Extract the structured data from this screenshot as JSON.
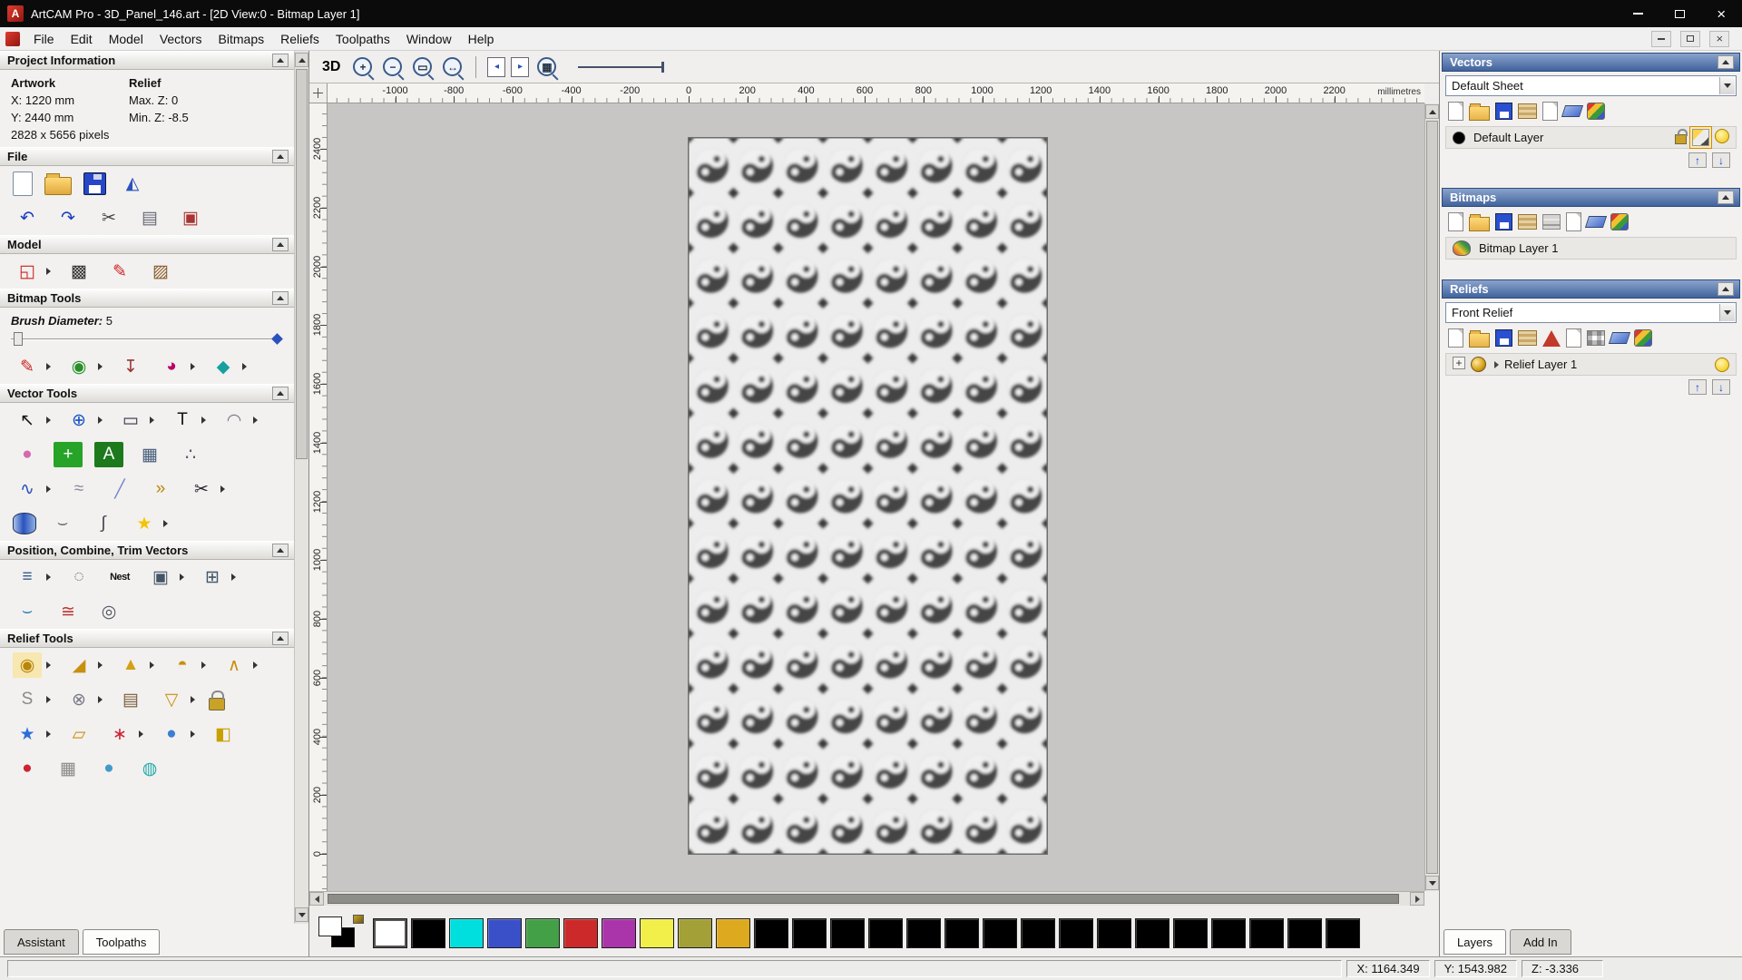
{
  "window": {
    "title": "ArtCAM Pro - 3D_Panel_146.art - [2D View:0 - Bitmap Layer 1]",
    "close_glyph": "×",
    "logo_letter": "A"
  },
  "menu": {
    "items": [
      "File",
      "Edit",
      "Model",
      "Vectors",
      "Bitmaps",
      "Reliefs",
      "Toolpaths",
      "Window",
      "Help"
    ]
  },
  "assistant": {
    "tabs": [
      {
        "label": "Assistant"
      },
      {
        "label": "Toolpaths"
      }
    ],
    "project_information": {
      "title": "Project Information",
      "artwork_header": "Artwork",
      "relief_header": "Relief",
      "artwork_x": "X: 1220 mm",
      "artwork_y": "Y: 2440 mm",
      "relief_max_z": "Max. Z: 0",
      "relief_min_z": "Min. Z: -8.5",
      "artwork_pixels": "2828 x 5656 pixels"
    },
    "sections": {
      "file": {
        "title": "File",
        "rows": [
          [
            {
              "n": "new-model-icon",
              "t": "page"
            },
            {
              "n": "open-model-icon",
              "t": "folder"
            },
            {
              "n": "save-model-icon",
              "t": "disk"
            },
            {
              "n": "import-model-icon",
              "g": "◭",
              "fg": "#2a52be"
            }
          ],
          [
            {
              "n": "undo-icon",
              "g": "↶",
              "fg": "#1a3fbf"
            },
            {
              "n": "redo-icon",
              "g": "↷",
              "fg": "#1a3fbf"
            },
            {
              "n": "cut-icon",
              "g": "✂",
              "fg": "#444444"
            },
            {
              "n": "copy-icon",
              "g": "▤",
              "fg": "#666677"
            },
            {
              "n": "paste-icon",
              "g": "▣",
              "fg": "#aa3333"
            }
          ]
        ]
      },
      "model": {
        "title": "Model",
        "rows": [
          [
            {
              "n": "set-model-size-icon",
              "g": "◱",
              "fg": "#cc2222",
              "a": 1
            },
            {
              "n": "adjust-lighting-icon",
              "g": "▩",
              "fg": "#333333"
            },
            {
              "n": "add-annotation-icon",
              "g": "✎",
              "fg": "#cc2222"
            },
            {
              "n": "model-preview-icon",
              "g": "▨",
              "fg": "#8a5a2b"
            }
          ]
        ]
      },
      "bitmap_tools": {
        "title": "Bitmap Tools",
        "brush_label": "Brush Diameter:",
        "brush_value": "5",
        "rows": [
          [
            {
              "n": "paint-brush-icon",
              "g": "✎",
              "fg": "#cc2222",
              "a": 1
            },
            {
              "n": "paint-selective-icon",
              "g": "◉",
              "fg": "#2a8f2a",
              "a": 1
            },
            {
              "n": "colour-picker-icon",
              "g": "↧",
              "fg": "#993333"
            },
            {
              "n": "palette-icon",
              "g": "◕",
              "fg": "#bb0066",
              "a": 1
            },
            {
              "n": "flood-fill-icon",
              "g": "◆",
              "fg": "#18a0a0",
              "a": 1
            }
          ]
        ]
      },
      "vector_tools": {
        "title": "Vector Tools",
        "rows": [
          [
            {
              "n": "select-vectors-icon",
              "g": "↖",
              "fg": "#111111",
              "a": 1
            },
            {
              "n": "transform-vectors-icon",
              "g": "⊕",
              "fg": "#1552c8",
              "a": 1
            },
            {
              "n": "rectangle-tool-icon",
              "g": "▭",
              "fg": "#333344",
              "a": 1
            },
            {
              "n": "text-tool-icon",
              "g": "T",
              "fg": "#111111",
              "a": 1
            },
            {
              "n": "measure-tool-icon",
              "g": "◠",
              "fg": "#777788",
              "a": 1
            }
          ],
          [
            {
              "n": "vector-doctor-icon",
              "g": "●",
              "fg": "#d668b0"
            },
            {
              "n": "polygon-tool-icon",
              "g": "+",
              "fg": "#ffffff",
              "bg": "#27a327"
            },
            {
              "n": "wrap-text-icon",
              "g": "A",
              "fg": "#ffffff",
              "bg": "#1c7a1c"
            },
            {
              "n": "paste-along-curve-icon",
              "g": "▦",
              "fg": "#445a7a"
            },
            {
              "n": "raster-to-vector-icon",
              "g": "∴",
              "fg": "#555566"
            }
          ],
          [
            {
              "n": "polyline-tool-icon",
              "g": "∿",
              "fg": "#2a52be",
              "a": 1
            },
            {
              "n": "smooth-polyline-icon",
              "g": "≈",
              "fg": "#888899"
            },
            {
              "n": "fit-arcs-icon",
              "g": "╱",
              "fg": "#7788cc"
            },
            {
              "n": "arc-tool-icon",
              "g": "»",
              "fg": "#b8860b"
            },
            {
              "n": "trim-tool-icon",
              "g": "✂",
              "fg": "#222233",
              "a": 1
            }
          ],
          [
            {
              "n": "cylinder-tool-icon",
              "t": "cyl"
            },
            {
              "n": "freehand-tool-icon",
              "g": "⌣",
              "fg": "#666677"
            },
            {
              "n": "node-editing-icon",
              "g": "∫",
              "fg": "#444455"
            },
            {
              "n": "star-tool-icon",
              "g": "★",
              "fg": "#f5c400",
              "a": 1
            }
          ]
        ]
      },
      "position_combine": {
        "title": "Position, Combine, Trim Vectors",
        "rows": [
          [
            {
              "n": "align-vectors-icon",
              "g": "≡",
              "fg": "#345a8a",
              "a": 1
            },
            {
              "n": "circular-array-icon",
              "g": "◌",
              "fg": "#555566"
            },
            {
              "n": "nesting-icon",
              "g": "Nest",
              "fg": "#111111",
              "small": 1
            },
            {
              "n": "group-vectors-icon",
              "g": "▣",
              "fg": "#445566",
              "a": 1
            },
            {
              "n": "weld-vectors-icon",
              "g": "⊞",
              "fg": "#445566",
              "a": 1
            }
          ],
          [
            {
              "n": "trim-fillet-icon",
              "g": "⌣",
              "fg": "#2a7fb8"
            },
            {
              "n": "mirror-merge-icon",
              "g": "≅",
              "fg": "#bb3333"
            },
            {
              "n": "spiral-tool-icon",
              "g": "◎",
              "fg": "#555566"
            }
          ]
        ]
      },
      "relief_tools": {
        "title": "Relief Tools",
        "rows": [
          [
            {
              "n": "shape-editor-icon",
              "g": "◉",
              "fg": "#b8860b",
              "bg": "#f7e7b0",
              "a": 1
            },
            {
              "n": "angled-plane-icon",
              "g": "◢",
              "fg": "#c89010",
              "a": 1
            },
            {
              "n": "extrude-wizard-icon",
              "g": "▲",
              "fg": "#d4a017",
              "a": 1
            },
            {
              "n": "turn-wizard-icon",
              "g": "◓",
              "fg": "#c89010",
              "a": 1
            },
            {
              "n": "two-rail-sweep-icon",
              "g": "∧",
              "fg": "#c89010",
              "a": 1
            }
          ],
          [
            {
              "n": "smooth-relief-icon",
              "g": "S",
              "fg": "#8a8a8a",
              "a": 1
            },
            {
              "n": "weave-wizard-icon",
              "g": "⊗",
              "fg": "#777788",
              "a": 1
            },
            {
              "n": "relief-clipart-icon",
              "g": "▤",
              "fg": "#7a5a3a"
            },
            {
              "n": "pour-relief-icon",
              "g": "▽",
              "fg": "#c89010",
              "a": 1
            },
            {
              "n": "reset-protect-icon",
              "t": "lock"
            }
          ],
          [
            {
              "n": "star-wizard-icon",
              "g": "★",
              "fg": "#2a6fd6",
              "a": 1
            },
            {
              "n": "envelope-distort-icon",
              "g": "▱",
              "fg": "#c89010"
            },
            {
              "n": "texture-relief-icon",
              "g": "∗",
              "fg": "#cc2233",
              "a": 1
            },
            {
              "n": "sphere-texture-icon",
              "g": "●",
              "fg": "#3a7fd0",
              "a": 1
            },
            {
              "n": "offset-relief-icon",
              "g": "◧",
              "fg": "#c8a000"
            }
          ],
          [
            {
              "n": "sculpt-icon",
              "g": "●",
              "fg": "#cc2233"
            },
            {
              "n": "relief-grid-icon",
              "g": "▦",
              "fg": "#888888"
            },
            {
              "n": "dome-icon",
              "g": "●",
              "fg": "#4499cc"
            },
            {
              "n": "wave-icon",
              "g": "◍",
              "fg": "#22aaaa"
            }
          ]
        ]
      }
    }
  },
  "canvas": {
    "toolbar": {
      "items": [
        {
          "n": "view-3d-button",
          "t": "txt",
          "g": "3D"
        },
        {
          "n": "zoom-in-icon",
          "t": "mag",
          "g": "+"
        },
        {
          "n": "zoom-out-icon",
          "t": "mag",
          "g": "−"
        },
        {
          "n": "zoom-box-icon",
          "t": "mag",
          "g": "▭"
        },
        {
          "n": "zoom-fit-icon",
          "t": "mag",
          "g": "↔"
        },
        {
          "n": "toolbar-separator",
          "t": "sep"
        },
        {
          "n": "view-back-icon",
          "t": "pg",
          "g": "◂"
        },
        {
          "n": "view-forward-icon",
          "t": "pg",
          "g": "▸"
        },
        {
          "n": "zoom-objects-icon",
          "t": "mag",
          "g": "▦"
        },
        {
          "n": "section-slider",
          "t": "slider-long"
        }
      ]
    },
    "h_ruler": {
      "labels": [
        "-1000",
        "-800",
        "-600",
        "-400",
        "-200",
        "0",
        "200",
        "400",
        "600",
        "800",
        "1000",
        "1200",
        "1400",
        "1600",
        "1800",
        "2000",
        "2200"
      ],
      "unit": "millimetres"
    },
    "v_ruler": {
      "labels": [
        "2400",
        "2200",
        "2000",
        "1800",
        "1600",
        "1400",
        "1200",
        "1000",
        "800",
        "600",
        "400",
        "200",
        "0"
      ]
    }
  },
  "layers_panel": {
    "vectors": {
      "title": "Vectors",
      "sheet_selector": "Default Sheet",
      "toolbar": [
        {
          "n": "new-vector-layer-icon",
          "t": "page"
        },
        {
          "n": "open-vector-layer-icon",
          "t": "folder"
        },
        {
          "n": "save-vector-layer-icon",
          "t": "disk"
        },
        {
          "n": "import-vectors-icon",
          "t": "stack"
        },
        {
          "n": "export-vectors-icon",
          "t": "page"
        },
        {
          "n": "delete-vector-layer-icon",
          "t": "eraser"
        },
        {
          "n": "merge-vector-layers-icon",
          "t": "merge"
        }
      ],
      "layer": {
        "name": "Default Layer",
        "controls": [
          {
            "n": "lock-layer-icon",
            "t": "lock"
          },
          {
            "n": "edit-layer-icon",
            "t": "pencil",
            "sel": 1
          },
          {
            "n": "layer-visibility-icon",
            "t": "bulb"
          }
        ]
      },
      "updown": [
        {
          "n": "vector-layer-up-icon",
          "t": "arrow",
          "g": "↑"
        },
        {
          "n": "vector-layer-down-icon",
          "t": "arrow",
          "g": "↓"
        }
      ]
    },
    "bitmaps": {
      "title": "Bitmaps",
      "toolbar": [
        {
          "n": "new-bitmap-layer-icon",
          "t": "page"
        },
        {
          "n": "open-bitmap-layer-icon",
          "t": "folder"
        },
        {
          "n": "save-bitmap-layer-icon",
          "t": "disk"
        },
        {
          "n": "import-bitmap-icon",
          "t": "stack"
        },
        {
          "n": "adjust-bitmap-icon",
          "t": "slider"
        },
        {
          "n": "copy-bitmap-layer-icon",
          "t": "page"
        },
        {
          "n": "delete-bitmap-layer-icon",
          "t": "eraser"
        },
        {
          "n": "merge-bitmap-layers-icon",
          "t": "merge"
        }
      ],
      "layer": {
        "name": "Bitmap Layer 1",
        "leading": [
          {
            "n": "painter-palette-icon",
            "t": "painter"
          }
        ]
      }
    },
    "reliefs": {
      "title": "Reliefs",
      "relief_selector": "Front Relief",
      "toolbar": [
        {
          "n": "new-relief-layer-icon",
          "t": "page"
        },
        {
          "n": "open-relief-layer-icon",
          "t": "folder"
        },
        {
          "n": "save-relief-layer-icon",
          "t": "disk"
        },
        {
          "n": "import-relief-icon",
          "t": "stack"
        },
        {
          "n": "triangulate-relief-icon",
          "t": "pyramid"
        },
        {
          "n": "copy-relief-layer-icon",
          "t": "page"
        },
        {
          "n": "relief-grid-icon",
          "t": "grid"
        },
        {
          "n": "delete-relief-layer-icon",
          "t": "eraser"
        },
        {
          "n": "merge-relief-layers-icon",
          "t": "merge"
        }
      ],
      "layer": {
        "name": "Relief Layer 1",
        "leading": [
          {
            "n": "add-relief-layer-icon",
            "t": "addbtn",
            "g": "+"
          },
          {
            "n": "relief-layer-icon",
            "t": "swirl"
          }
        ],
        "trailing": [
          {
            "n": "relief-visibility-icon",
            "t": "bulb"
          }
        ]
      },
      "updown": [
        {
          "n": "relief-layer-up-icon",
          "t": "arrow",
          "g": "↑"
        },
        {
          "n": "relief-layer-down-icon",
          "t": "arrow",
          "g": "↓"
        }
      ]
    },
    "tabs": [
      {
        "label": "Layers"
      },
      {
        "label": "Add In"
      }
    ]
  },
  "palette": {
    "colors": [
      "#ffffff",
      "#000000",
      "#00dede",
      "#3a50c8",
      "#43a047",
      "#cc2a2a",
      "#aa35aa",
      "#f2ee4a",
      "#a3a038",
      "#dca91f",
      "#000000",
      "#000000",
      "#000000",
      "#000000",
      "#000000",
      "#000000",
      "#000000",
      "#000000",
      "#000000",
      "#000000",
      "#000000",
      "#000000",
      "#000000",
      "#000000",
      "#000000",
      "#000000"
    ]
  },
  "status": {
    "x": "X: 1164.349",
    "y": "Y: 1543.982",
    "z": "Z: -3.336"
  }
}
